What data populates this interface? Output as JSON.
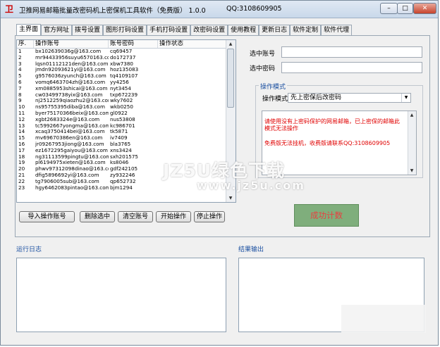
{
  "window": {
    "title": "卫推网易邮箱批量改密码机上密保机工具软件（免费版） 1.0.0",
    "qq": "QQ:3108609905",
    "minimize": "–",
    "maximize": "□",
    "close": "✕"
  },
  "tabs": [
    "主界面",
    "官方网址",
    "拨号设置",
    "图形打码设置",
    "手机打码设置",
    "改密码设置",
    "使用教程",
    "更新日志",
    "软件定制",
    "软件代理"
  ],
  "grid": {
    "headers": [
      "序.",
      "操作账号",
      "账号密码",
      "操作状态"
    ],
    "rows": [
      [
        "1",
        "bx102639036g@163.com",
        "cq69457",
        ""
      ],
      [
        "2",
        "mr94433956suyu6570163.com",
        "do172737",
        ""
      ],
      [
        "3",
        "lqsn01112121den@163.com",
        "xbw7380",
        ""
      ],
      [
        "4",
        "jmdn92093621yi@163.com",
        "hoz135083",
        ""
      ],
      [
        "5",
        "g9576036zyunch@163.com",
        "tq4109107",
        ""
      ],
      [
        "6",
        "vomq6463704zh@163.com",
        "yy4256",
        ""
      ],
      [
        "7",
        "xm0885953shicai@163.com",
        "nyt3454",
        ""
      ],
      [
        "8",
        "cw03499738yix@163.com",
        "txp672239",
        ""
      ],
      [
        "9",
        "nj2512259qiaozhu2@163.com",
        "wky7602",
        ""
      ],
      [
        "10",
        "ns95755395diba@163.com",
        "wkb0250",
        ""
      ],
      [
        "11",
        "byer75170366beix@163.com",
        "gl0922",
        ""
      ],
      [
        "12",
        "xgbt2683324e@163.com",
        "nus53808",
        ""
      ],
      [
        "13",
        "tc5992667yongma@163.com",
        "kc986701",
        ""
      ],
      [
        "14",
        "xcaq3750414bei@163.com",
        "tk5871",
        ""
      ],
      [
        "15",
        "mv69670386en@163.com",
        "iv7409",
        ""
      ],
      [
        "16",
        "jr09267953jiong@163.com",
        "bla3765",
        ""
      ],
      [
        "17",
        "ez1672295gaiyou@163.com",
        "xns3424",
        ""
      ],
      [
        "18",
        "ng31113599pingtu@163.com",
        "sxh201575",
        ""
      ],
      [
        "19",
        "pl6194975xieten@163.com",
        "ks8046",
        ""
      ],
      [
        "20",
        "phwv97312098dinao@163.com",
        "gdf242105",
        ""
      ],
      [
        "21",
        "dfig5896692yi@163.com",
        "zy932246",
        ""
      ],
      [
        "22",
        "tg7906005sub@163.com",
        "qp652732",
        ""
      ],
      [
        "23",
        "hgy6462083pintao@163.com",
        "bjm1294",
        ""
      ]
    ]
  },
  "buttons": {
    "import": "导入操作账号",
    "delete": "删除选中",
    "clear": "清空账号",
    "start": "开始操作",
    "stop": "停止操作"
  },
  "form": {
    "account_label": "选中账号",
    "account_value": "",
    "password_label": "选中密码",
    "password_value": ""
  },
  "mode": {
    "group_title": "操作模式",
    "label": "操作模式",
    "selected": "先上密保后改密码",
    "message_line1": "请使用没有上密码保护的网易邮箱，已上密保的邮箱此模式无法操作",
    "message_line2": "免费版无法挂机，收费版请联系QQ:3108609905"
  },
  "success_label": "成功计数",
  "log": {
    "title": "运行日志"
  },
  "result": {
    "title": "结果输出"
  },
  "watermark": {
    "text": "JZ5U绿色下载",
    "url": "www.jz5u.com"
  },
  "colors": {
    "warning_text": "#e00000",
    "success_bg": "#7fae7c",
    "section_title": "#1a4fa0"
  }
}
